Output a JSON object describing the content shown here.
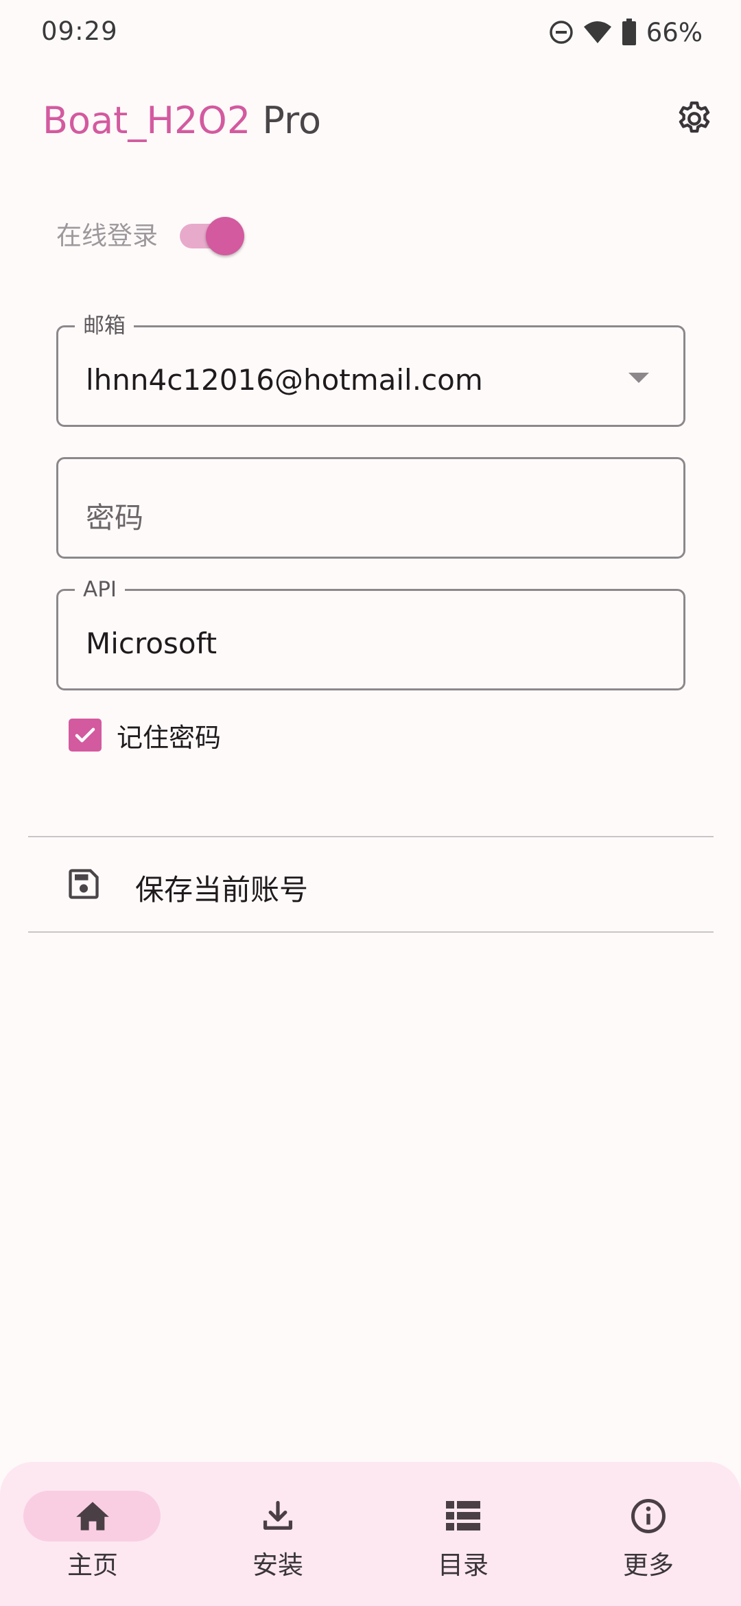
{
  "status_bar": {
    "time": "09:29",
    "battery": "66%",
    "icons": [
      "do-not-disturb-icon",
      "wifi-icon",
      "battery-icon"
    ]
  },
  "app_bar": {
    "title_brand": "Boat_H2O2",
    "title_suffix": " Pro",
    "settings_icon": "gear-icon"
  },
  "login": {
    "online_label": "在线登录",
    "online_enabled": true,
    "email_label": "邮箱",
    "email_value": "lhnn4c12016@hotmail.com",
    "password_placeholder": "密码",
    "api_label": "API",
    "api_value": "Microsoft",
    "remember_label": "记住密码",
    "remember_checked": true
  },
  "actions": {
    "save_account_label": "保存当前账号",
    "save_icon": "save-icon"
  },
  "bottom_nav": {
    "items": [
      {
        "label": "主页",
        "icon": "home-icon",
        "active": true
      },
      {
        "label": "安装",
        "icon": "download-icon",
        "active": false
      },
      {
        "label": "目录",
        "icon": "list-icon",
        "active": false
      },
      {
        "label": "更多",
        "icon": "info-icon",
        "active": false
      }
    ]
  },
  "colors": {
    "accent": "#d35a9f",
    "accent_light": "#e8aacb",
    "nav_background": "#fde8f1",
    "nav_active_pill": "#f9cee3",
    "background": "#fffafa"
  }
}
